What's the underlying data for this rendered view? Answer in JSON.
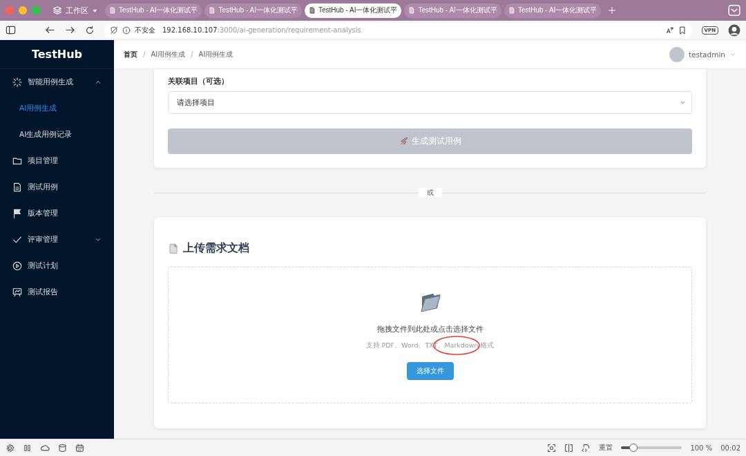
{
  "browser": {
    "workspace": "工作区",
    "tabs": [
      {
        "title": "TestHub - AI一体化测试平",
        "selected": false
      },
      {
        "title": "TestHub - AI一体化测试平",
        "selected": false
      },
      {
        "title": "TestHub - AI一体化测试平",
        "selected": true
      },
      {
        "title": "TestHub - AI一体化测试平",
        "selected": false
      },
      {
        "title": "TestHub - AI一体化测试平",
        "selected": false
      }
    ],
    "security": "不安全",
    "url_host": "192.168.10.107",
    "url_path": ":3000/ai-generation/requirement-analysis",
    "vpn": "VPN"
  },
  "sidebar": {
    "logo": "TestHub",
    "items": [
      {
        "label": "智能用例生成",
        "kind": "group",
        "expanded": true,
        "selected": false,
        "children": [
          {
            "label": "AI用例生成",
            "selected": true
          },
          {
            "label": "AI生成用例记录",
            "selected": false
          }
        ]
      },
      {
        "label": "项目管理",
        "kind": "link",
        "selected": false
      },
      {
        "label": "测试用例",
        "kind": "link",
        "selected": false
      },
      {
        "label": "版本管理",
        "kind": "link",
        "selected": false
      },
      {
        "label": "评审管理",
        "kind": "group",
        "expanded": false,
        "selected": false
      },
      {
        "label": "测试计划",
        "kind": "link",
        "selected": false
      },
      {
        "label": "测试报告",
        "kind": "link",
        "selected": false
      }
    ]
  },
  "header": {
    "breadcrumb": [
      "首页",
      "AI用例生成",
      "AI用例生成"
    ],
    "separators": [
      "/",
      "/"
    ],
    "user": "testadmin"
  },
  "project_card": {
    "label": "关联项目（可选）",
    "select_placeholder": "请选择项目",
    "generate_button": {
      "label": "生成测试用例",
      "disabled": true
    }
  },
  "divider": "或",
  "upload_card": {
    "title": "上传需求文档",
    "drop_text": "拖拽文件到此处或点击选择文件",
    "hint": "支持 PDF、Word、TXT、Markdown 格式",
    "button": "选择文件"
  },
  "status_bar": {
    "reset": "重置",
    "zoom": {
      "level": 0.2
    },
    "zoom_text": "100 %",
    "time": "00:02"
  }
}
